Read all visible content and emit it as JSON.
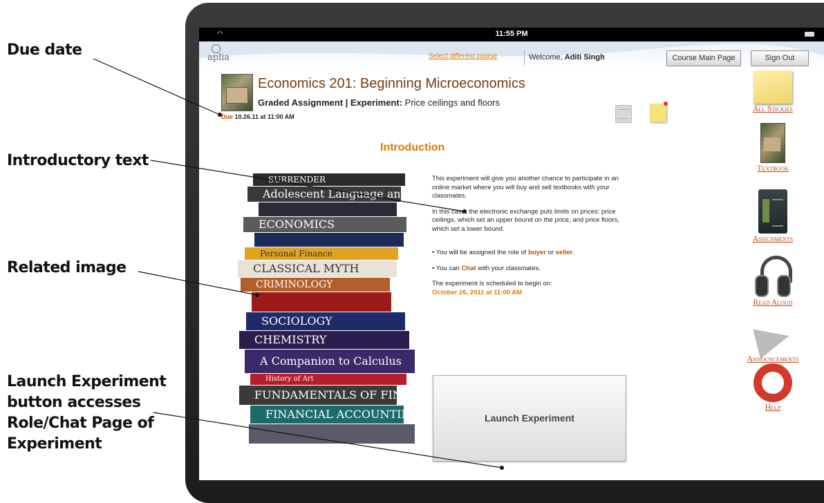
{
  "callouts": {
    "due_date": "Due date",
    "intro_text": "Introductory text",
    "related_image": "Related image",
    "launch_line1": "Launch Experiment",
    "launch_line2": "button accesses",
    "launch_line3": "Role/Chat Page of",
    "launch_line4": "Experiment"
  },
  "status_bar": {
    "time": "11:55 PM"
  },
  "header": {
    "logo": "aplia",
    "select_course": "Select different course",
    "welcome_prefix": "Welcome, ",
    "user_name": "Aditi Singh",
    "course_main_page": "Course Main Page",
    "sign_out": "Sign Out"
  },
  "course": {
    "title": "Economics 201: Beginning Microeconomics",
    "assignment_type": "Graded Assignment | Experiment:",
    "assignment_name": " Price ceilings and floors",
    "due_label": "Due",
    "due_value": " 10.26.11 at 11:00 AM"
  },
  "intro": {
    "heading": "Introduction",
    "p1": "This experiment will give you another chance to participate in an online market where you will buy and sell textbooks with your classmates.",
    "p2": "In this case, the electronic exchange puts limits on prices: price ceilings, which set an upper bound on the price, and price floors, which set a lower bound.",
    "role_prefix": "• You will be assigned the role of ",
    "role_buyer": "buyer",
    "role_or": " or ",
    "role_seller": "seller",
    "role_end": ".",
    "chat_prefix": "• You can ",
    "chat_word": "Chat",
    "chat_suffix": " with your classmates.",
    "schedule_label": "The experiment is scheduled to begin on:",
    "schedule_date": "October 26, 2011 at 11:00 AM"
  },
  "launch_button": "Launch Experiment",
  "books": [
    "SURRENDER",
    "Adolescent Language and Learning",
    "",
    "ECONOMICS",
    "",
    "Personal Finance",
    "CLASSICAL MYTH",
    "CRIMINOLOGY",
    "",
    "SOCIOLOGY",
    "CHEMISTRY",
    "A Companion to Calculus",
    "History of Art",
    "FUNDAMENTALS OF FINANCIAL MANAGEMENT",
    "FINANCIAL ACCOUNTING"
  ],
  "sidebar": [
    {
      "label": "All Stickies",
      "icon": "sticky-note-icon"
    },
    {
      "label": "Textbook",
      "icon": "textbook-icon"
    },
    {
      "label": "Assignments",
      "icon": "assignments-icon"
    },
    {
      "label": "Read Aloud",
      "icon": "headphones-icon"
    },
    {
      "label": "Announcements",
      "icon": "megaphone-icon"
    },
    {
      "label": "Help",
      "icon": "lifebuoy-icon"
    }
  ],
  "colors": {
    "accent": "#e07b00",
    "title": "#7a3a0a",
    "sidebar_label": "#b9471a"
  }
}
